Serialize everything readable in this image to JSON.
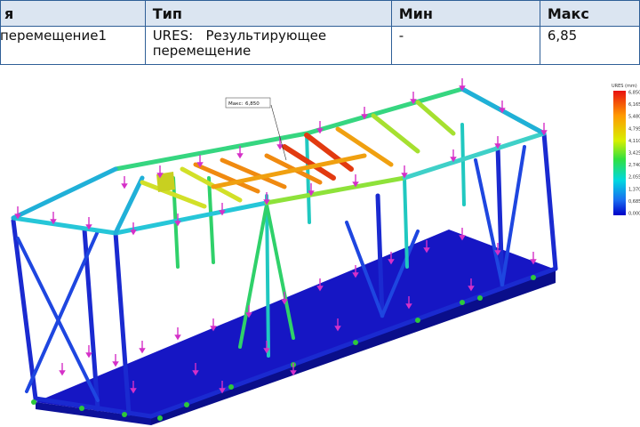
{
  "table": {
    "headers": [
      "я",
      "Тип",
      "Мин",
      "Макс"
    ],
    "row": {
      "name": "перемещение1",
      "type_line1": "URES:   Результирующее",
      "type_line2": "перемещение",
      "min": "-",
      "max": "6,85"
    }
  },
  "callout": {
    "label": "Макс:",
    "value": "6,850"
  },
  "legend": {
    "title": "URES (mm)",
    "ticks": [
      "6,850",
      "6,165",
      "5,480",
      "4,795",
      "4,110",
      "3,425",
      "2,740",
      "2,055",
      "1,370",
      "0,685",
      "0,000"
    ]
  }
}
